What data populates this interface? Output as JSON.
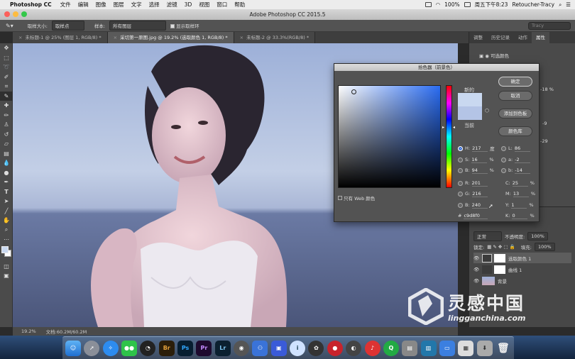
{
  "menubar": {
    "app": "Photoshop CC",
    "items": [
      "文件",
      "编辑",
      "图像",
      "图层",
      "文字",
      "选择",
      "滤镜",
      "3D",
      "视图",
      "窗口",
      "帮助"
    ],
    "battery": "100%",
    "clock": "周五下午8:23",
    "user": "Retoucher-Tracy"
  },
  "window": {
    "title": "Adobe Photoshop CC 2015.5"
  },
  "options": {
    "sample_size_label": "取样大小:",
    "sample_size_value": "取样点",
    "sample_label": "样本:",
    "sample_value": "所有图层",
    "show_ring": "显示取样环",
    "search_placeholder": "Tracy"
  },
  "tabs": [
    {
      "label": "未标题-1 @ 25% (图层 1, RGB/8) *",
      "active": false
    },
    {
      "label": "采切第一原图.jpg @ 19.2% (选取颜色 1, RGB/8) *",
      "active": true
    },
    {
      "label": "未标题-2 @ 33.3%(RGB/8) *",
      "active": false
    }
  ],
  "panel": {
    "tabs": [
      "调整",
      "历史记录",
      "动作",
      "属性"
    ],
    "props_title": "可选颜色",
    "side_values": [
      "-18",
      "%",
      "-9",
      "-29"
    ],
    "layer_mode": "正常",
    "opacity_label": "不透明度:",
    "opacity": "100%",
    "lock_label": "锁定:",
    "fill_label": "填充:",
    "fill": "100%",
    "layers": [
      {
        "name": "选取颜色 1"
      },
      {
        "name": "曲线 1"
      },
      {
        "name": "背景"
      }
    ]
  },
  "picker": {
    "title": "拾色器（前景色）",
    "new_label": "新的",
    "current_label": "当前",
    "ok": "确定",
    "cancel": "取消",
    "add_swatch": "添加到色板",
    "libraries": "颜色库",
    "web_only": "只有 Web 颜色",
    "H": "217",
    "H_unit": "度",
    "S": "16",
    "B": "94",
    "R": "201",
    "G": "216",
    "Bv": "240",
    "L": "86",
    "a": "-2",
    "b": "-14",
    "C": "25",
    "M": "13",
    "Y": "1",
    "K": "0",
    "pct": "%",
    "hex": "c9d8f0",
    "new_color": "#c9d8f0",
    "current_color": "#b4c4e6"
  },
  "status": {
    "zoom": "19.2%",
    "doc": "文档:60.2M/60.2M"
  },
  "watermark": {
    "text": "灵感中国",
    "url": "lingganchina.com"
  }
}
